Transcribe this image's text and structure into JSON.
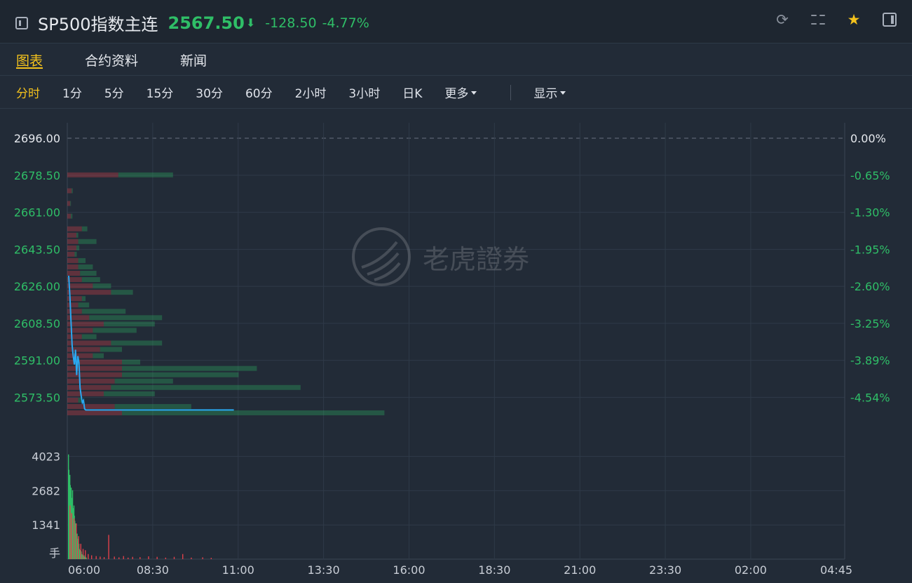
{
  "header": {
    "title": "SP500指数主连",
    "price": "2567.50",
    "arrow": "⬇",
    "change": "-128.50",
    "change_pct": "-4.77%"
  },
  "tabs": [
    {
      "label": "图表",
      "active": true
    },
    {
      "label": "合约资料",
      "active": false
    },
    {
      "label": "新闻",
      "active": false
    }
  ],
  "periods": [
    {
      "label": "分时",
      "active": true
    },
    {
      "label": "1分"
    },
    {
      "label": "5分"
    },
    {
      "label": "15分"
    },
    {
      "label": "30分"
    },
    {
      "label": "60分"
    },
    {
      "label": "2小时"
    },
    {
      "label": "3小时"
    },
    {
      "label": "日K"
    },
    {
      "label": "更多",
      "dropdown": true
    },
    {
      "label": "显示",
      "dropdown": true
    }
  ],
  "watermark": "老虎證券",
  "colors": {
    "up": "#e0404a",
    "down": "#2fbe67",
    "accent": "#f4c21c",
    "price_line": "#29a8f0"
  },
  "chart_data": {
    "type": "line",
    "price_axis": {
      "ticks": [
        "2696.00",
        "2678.50",
        "2661.00",
        "2643.50",
        "2626.00",
        "2608.50",
        "2591.00",
        "2573.50"
      ],
      "pct_ticks": [
        "0.00%",
        "-0.65%",
        "-1.30%",
        "-1.95%",
        "-2.60%",
        "-3.25%",
        "-3.89%",
        "-4.54%"
      ],
      "ylim": [
        2564,
        2700
      ],
      "reference": 2696.0
    },
    "volume_axis": {
      "ticks": [
        "4023",
        "2682",
        "1341"
      ],
      "unit": "手",
      "ylim": [
        0,
        5000
      ]
    },
    "time_axis": {
      "labels": [
        "06:00",
        "08:30",
        "11:00",
        "13:30",
        "16:00",
        "18:30",
        "21:00",
        "23:30",
        "02:00",
        "04:45"
      ],
      "session_minutes": 1365
    },
    "price_series": [
      {
        "t": 0,
        "p": 2631
      },
      {
        "t": 2,
        "p": 2622
      },
      {
        "t": 4,
        "p": 2610
      },
      {
        "t": 6,
        "p": 2598
      },
      {
        "t": 8,
        "p": 2593
      },
      {
        "t": 10,
        "p": 2589
      },
      {
        "t": 12,
        "p": 2596
      },
      {
        "t": 14,
        "p": 2584
      },
      {
        "t": 16,
        "p": 2593
      },
      {
        "t": 18,
        "p": 2590
      },
      {
        "t": 20,
        "p": 2578
      },
      {
        "t": 22,
        "p": 2574
      },
      {
        "t": 24,
        "p": 2571
      },
      {
        "t": 26,
        "p": 2572
      },
      {
        "t": 28,
        "p": 2568
      },
      {
        "t": 30,
        "p": 2567.5
      },
      {
        "t": 290,
        "p": 2567.5
      }
    ],
    "volume_profile": [
      {
        "price": 2678.5,
        "buy": 1400,
        "sell": 1500
      },
      {
        "price": 2671,
        "buy": 120,
        "sell": 30
      },
      {
        "price": 2665,
        "buy": 80,
        "sell": 20
      },
      {
        "price": 2659,
        "buy": 100,
        "sell": 40
      },
      {
        "price": 2653,
        "buy": 400,
        "sell": 150
      },
      {
        "price": 2650,
        "buy": 250,
        "sell": 50
      },
      {
        "price": 2647,
        "buy": 300,
        "sell": 500
      },
      {
        "price": 2644,
        "buy": 250,
        "sell": 80
      },
      {
        "price": 2641,
        "buy": 200,
        "sell": 60
      },
      {
        "price": 2638,
        "buy": 300,
        "sell": 200
      },
      {
        "price": 2635,
        "buy": 300,
        "sell": 400
      },
      {
        "price": 2632,
        "buy": 350,
        "sell": 450
      },
      {
        "price": 2629,
        "buy": 400,
        "sell": 500
      },
      {
        "price": 2626,
        "buy": 700,
        "sell": 500
      },
      {
        "price": 2623,
        "buy": 1200,
        "sell": 600
      },
      {
        "price": 2620,
        "buy": 400,
        "sell": 100
      },
      {
        "price": 2617,
        "buy": 300,
        "sell": 300
      },
      {
        "price": 2614,
        "buy": 400,
        "sell": 1200
      },
      {
        "price": 2611,
        "buy": 600,
        "sell": 2000
      },
      {
        "price": 2608,
        "buy": 1000,
        "sell": 1400
      },
      {
        "price": 2605,
        "buy": 700,
        "sell": 1200
      },
      {
        "price": 2602,
        "buy": 400,
        "sell": 400
      },
      {
        "price": 2599,
        "buy": 1200,
        "sell": 1400
      },
      {
        "price": 2596,
        "buy": 900,
        "sell": 600
      },
      {
        "price": 2593,
        "buy": 700,
        "sell": 300
      },
      {
        "price": 2590,
        "buy": 1500,
        "sell": 500
      },
      {
        "price": 2587,
        "buy": 1500,
        "sell": 3700
      },
      {
        "price": 2584,
        "buy": 1500,
        "sell": 3200
      },
      {
        "price": 2581,
        "buy": 1300,
        "sell": 1600
      },
      {
        "price": 2578,
        "buy": 1200,
        "sell": 5200
      },
      {
        "price": 2575,
        "buy": 1000,
        "sell": 1400
      },
      {
        "price": 2572,
        "buy": 300,
        "sell": 100
      },
      {
        "price": 2569,
        "buy": 1300,
        "sell": 2100
      },
      {
        "price": 2566,
        "buy": 1500,
        "sell": 7200
      }
    ],
    "volume_bars": {
      "green": [
        4100,
        3500,
        3100,
        3300,
        2900,
        2600,
        2800,
        2400,
        2200,
        2700,
        2000,
        1800,
        2100,
        1700,
        1500,
        1200,
        1400,
        1100,
        900,
        1000,
        700,
        800,
        500,
        600,
        400,
        300,
        350,
        250,
        300,
        200,
        150,
        180,
        120,
        100,
        150,
        90,
        80,
        110,
        70,
        60
      ],
      "red": [
        {
          "t": 2,
          "v": 2100
        },
        {
          "t": 5,
          "v": 1800
        },
        {
          "t": 9,
          "v": 1600
        },
        {
          "t": 13,
          "v": 1400
        },
        {
          "t": 17,
          "v": 900
        },
        {
          "t": 21,
          "v": 600
        },
        {
          "t": 25,
          "v": 400
        },
        {
          "t": 29,
          "v": 350
        },
        {
          "t": 34,
          "v": 200
        },
        {
          "t": 40,
          "v": 150
        },
        {
          "t": 48,
          "v": 120
        },
        {
          "t": 55,
          "v": 100
        },
        {
          "t": 62,
          "v": 80
        },
        {
          "t": 70,
          "v": 950
        },
        {
          "t": 80,
          "v": 100
        },
        {
          "t": 88,
          "v": 70
        },
        {
          "t": 96,
          "v": 120
        },
        {
          "t": 104,
          "v": 60
        },
        {
          "t": 112,
          "v": 90
        },
        {
          "t": 125,
          "v": 80
        },
        {
          "t": 140,
          "v": 110
        },
        {
          "t": 155,
          "v": 90
        },
        {
          "t": 170,
          "v": 60
        },
        {
          "t": 185,
          "v": 90
        },
        {
          "t": 200,
          "v": 200
        },
        {
          "t": 215,
          "v": 60
        },
        {
          "t": 235,
          "v": 70
        },
        {
          "t": 250,
          "v": 50
        }
      ]
    }
  }
}
